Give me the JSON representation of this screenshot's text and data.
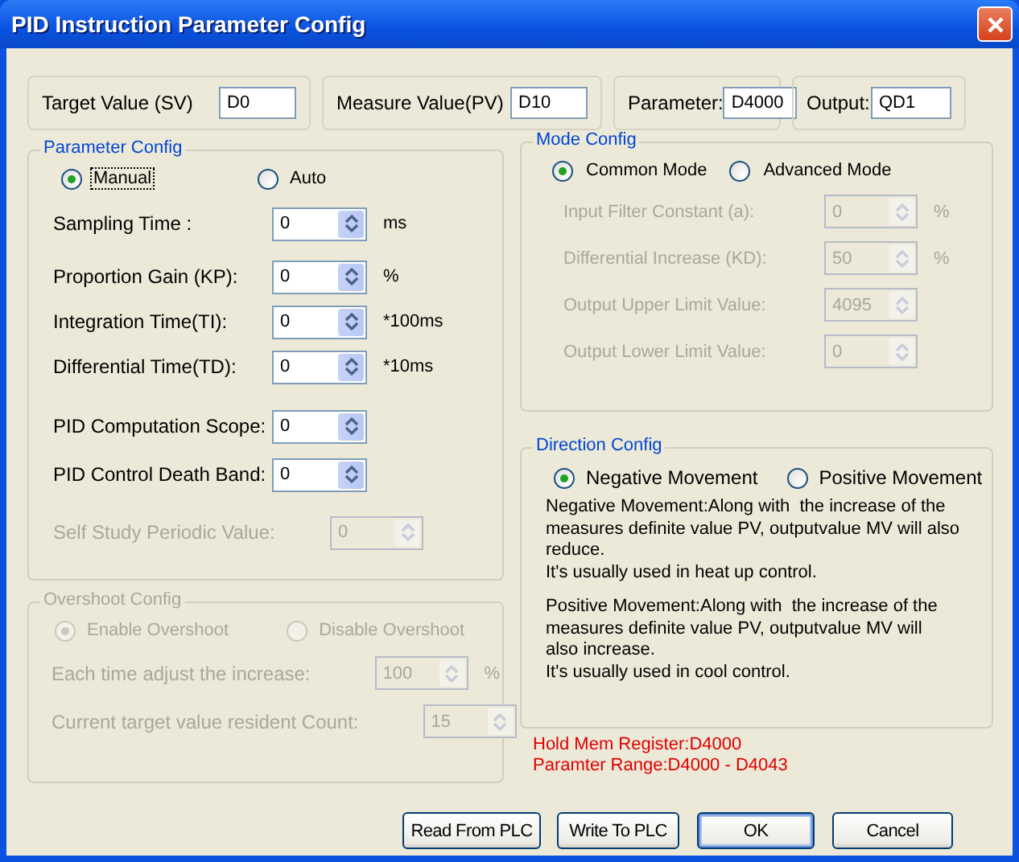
{
  "window": {
    "title": "PID Instruction Parameter Config"
  },
  "io_fields": [
    {
      "label": "Target Value (SV)",
      "value": "D0"
    },
    {
      "label": "Measure Value(PV)",
      "value": "D10"
    },
    {
      "label": "Parameter:",
      "value": "D4000"
    },
    {
      "label": "Output:",
      "value": "QD1"
    }
  ],
  "parameter_config": {
    "title": "Parameter Config",
    "disabled": false,
    "radios": [
      {
        "label": "Manual",
        "selected": true,
        "focused": true
      },
      {
        "label": "Auto",
        "selected": false,
        "focused": false
      }
    ],
    "fields": [
      {
        "label": "Sampling Time :",
        "value": "0",
        "unit": "ms",
        "disabled": false
      },
      {
        "label": "Proportion Gain (KP):",
        "value": "0",
        "unit": "%",
        "disabled": false
      },
      {
        "label": "Integration Time(TI):",
        "value": "0",
        "unit": "*100ms",
        "disabled": false
      },
      {
        "label": "Differential Time(TD):",
        "value": "0",
        "unit": "*10ms",
        "disabled": false
      },
      {
        "label": "PID Computation Scope:",
        "value": "0",
        "disabled": false
      },
      {
        "label": "PID Control Death Band:",
        "value": "0",
        "disabled": false
      },
      {
        "label": "Self Study Periodic Value:",
        "value": "0",
        "disabled": true
      }
    ]
  },
  "overshoot_config": {
    "title": "Overshoot Config",
    "disabled": true,
    "radios": [
      {
        "label": "Enable Overshoot",
        "selected": true,
        "focused": false
      },
      {
        "label": "Disable Overshoot",
        "selected": false,
        "focused": false
      }
    ],
    "fields": [
      {
        "label": "Each time adjust the increase:",
        "value": "100",
        "unit": "%",
        "disabled": true
      },
      {
        "label": "Current target value resident Count:",
        "value": "15",
        "disabled": true
      }
    ]
  },
  "mode_config": {
    "title": "Mode Config",
    "disabled": false,
    "radios": [
      {
        "label": "Common Mode",
        "selected": true,
        "focused": false
      },
      {
        "label": "Advanced Mode",
        "selected": false,
        "focused": false
      }
    ],
    "fields": [
      {
        "label": "Input Filter Constant (a):",
        "value": "0",
        "unit": "%",
        "disabled": true
      },
      {
        "label": "Differential Increase (KD):",
        "value": "50",
        "unit": "%",
        "disabled": true
      },
      {
        "label": "Output Upper Limit Value:",
        "value": "4095",
        "disabled": true
      },
      {
        "label": "Output Lower Limit Value:",
        "value": "0",
        "disabled": true
      }
    ]
  },
  "direction_config": {
    "title": "Direction Config",
    "disabled": false,
    "radios": [
      {
        "label": "Negative Movement",
        "selected": true,
        "focused": false
      },
      {
        "label": "Positive Movement",
        "selected": false,
        "focused": false
      }
    ],
    "paragraphs": [
      "Negative Movement:Along with  the increase of the\nmeasures definite value PV, outputvalue MV will also\nreduce.\nIt's usually used in heat up control.",
      "Positive Movement:Along with  the increase of the\nmeasures definite value PV, outputvalue MV will\nalso increase.\nIt's usually used in cool control."
    ]
  },
  "register_info": [
    "Hold Mem Register:D4000",
    "Paramter Range:D4000 - D4043"
  ],
  "buttons": [
    {
      "label": "Read From PLC",
      "default": false
    },
    {
      "label": "Write To PLC",
      "default": false
    },
    {
      "label": "OK",
      "default": true
    },
    {
      "label": "Cancel",
      "default": false
    }
  ]
}
